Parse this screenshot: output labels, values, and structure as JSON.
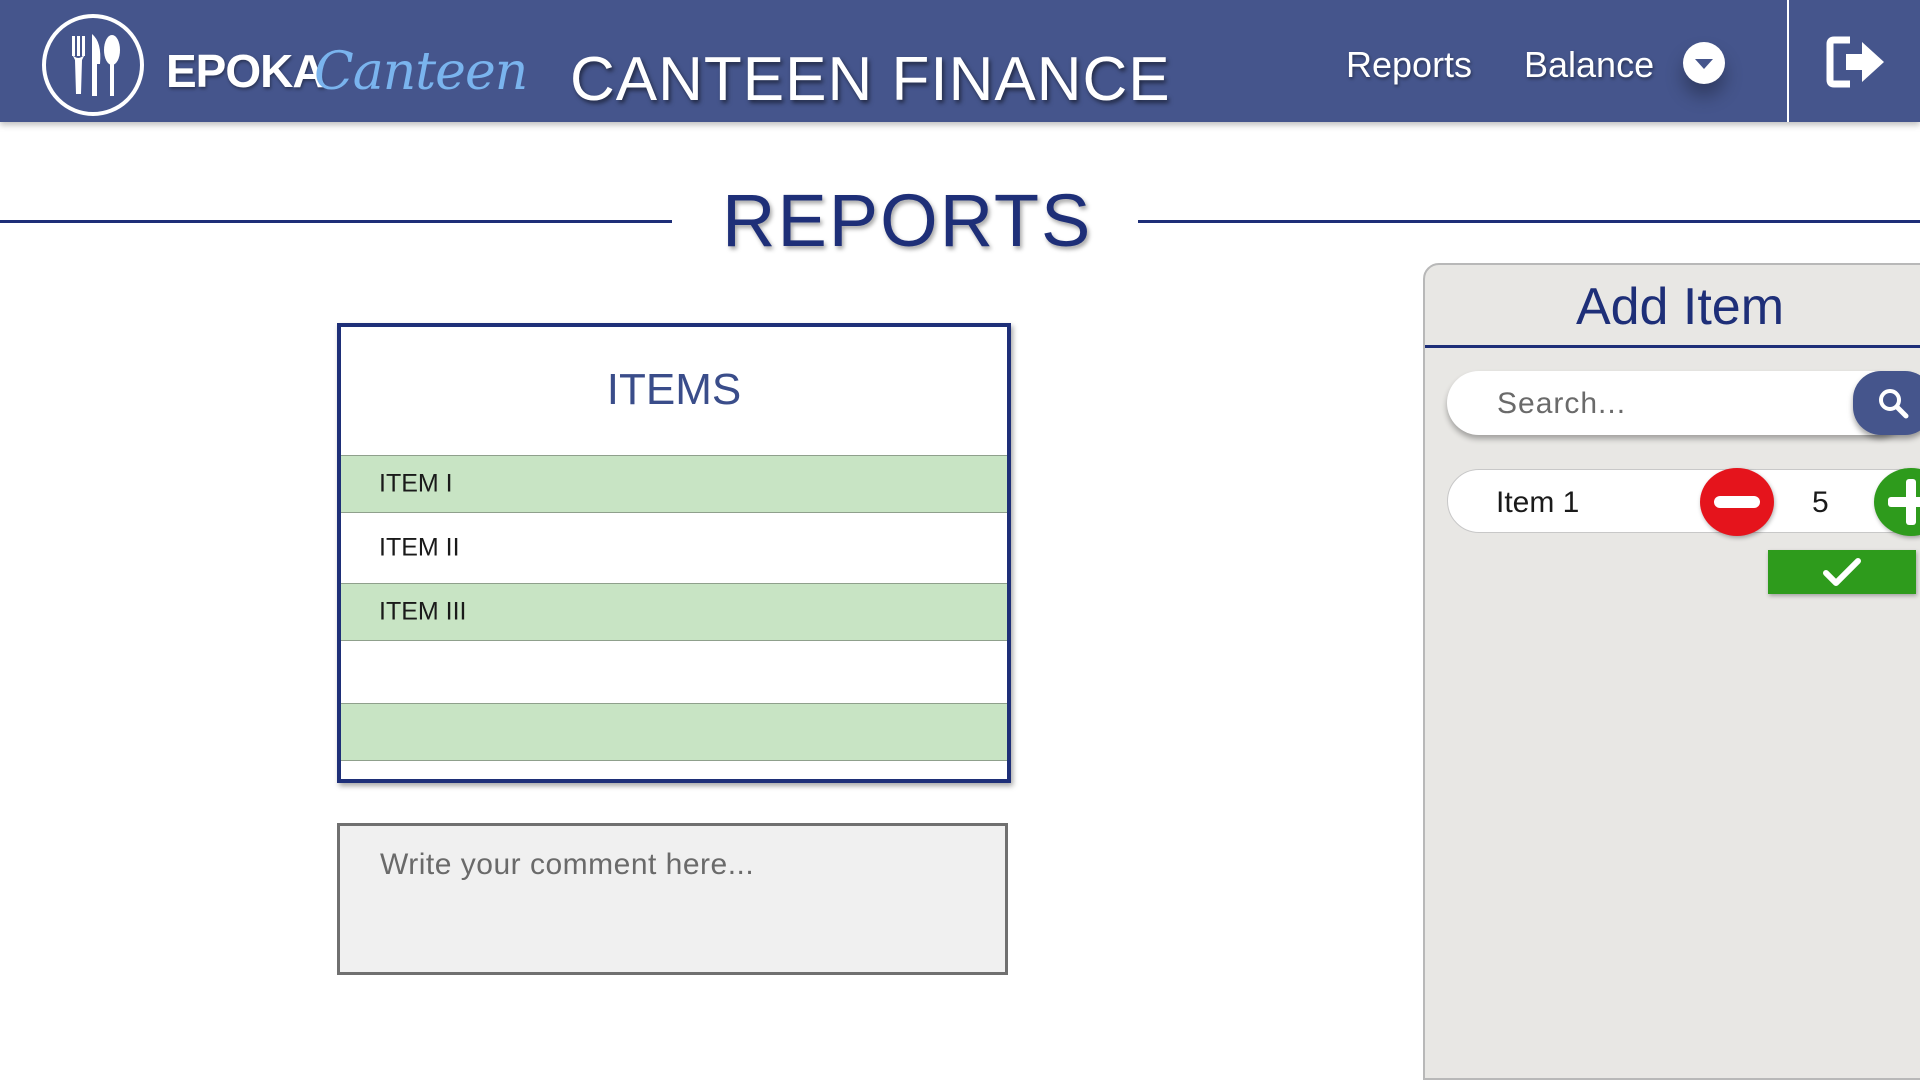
{
  "header": {
    "brand_primary": "EPOKA",
    "brand_secondary": "Canteen",
    "title": "CANTEEN FINANCE",
    "nav": {
      "reports_label": "Reports",
      "balance_label": "Balance"
    },
    "logo_icon": "fork-knife-spoon-icon",
    "dropdown_icon": "chevron-down-icon",
    "logout_icon": "logout-icon"
  },
  "page": {
    "title": "REPORTS"
  },
  "items_panel": {
    "heading": "ITEMS",
    "rows": [
      "ITEM I",
      "ITEM II",
      "ITEM III",
      "",
      ""
    ]
  },
  "comment": {
    "placeholder": "Write your comment here..."
  },
  "add_item": {
    "title": "Add Item",
    "search_placeholder": "Search...",
    "search_icon": "search-icon",
    "entry": {
      "name": "Item 1",
      "quantity": "5"
    },
    "confirm_icon": "checkmark-icon"
  },
  "colors": {
    "header_bg": "#45558c",
    "brand_accent": "#7ab4ee",
    "primary_navy": "#1e2f78",
    "row_green": "#c8e4c4",
    "panel_bg": "#e8e7e4",
    "minus_red": "#e5141c",
    "plus_green": "#2e9b1c"
  }
}
